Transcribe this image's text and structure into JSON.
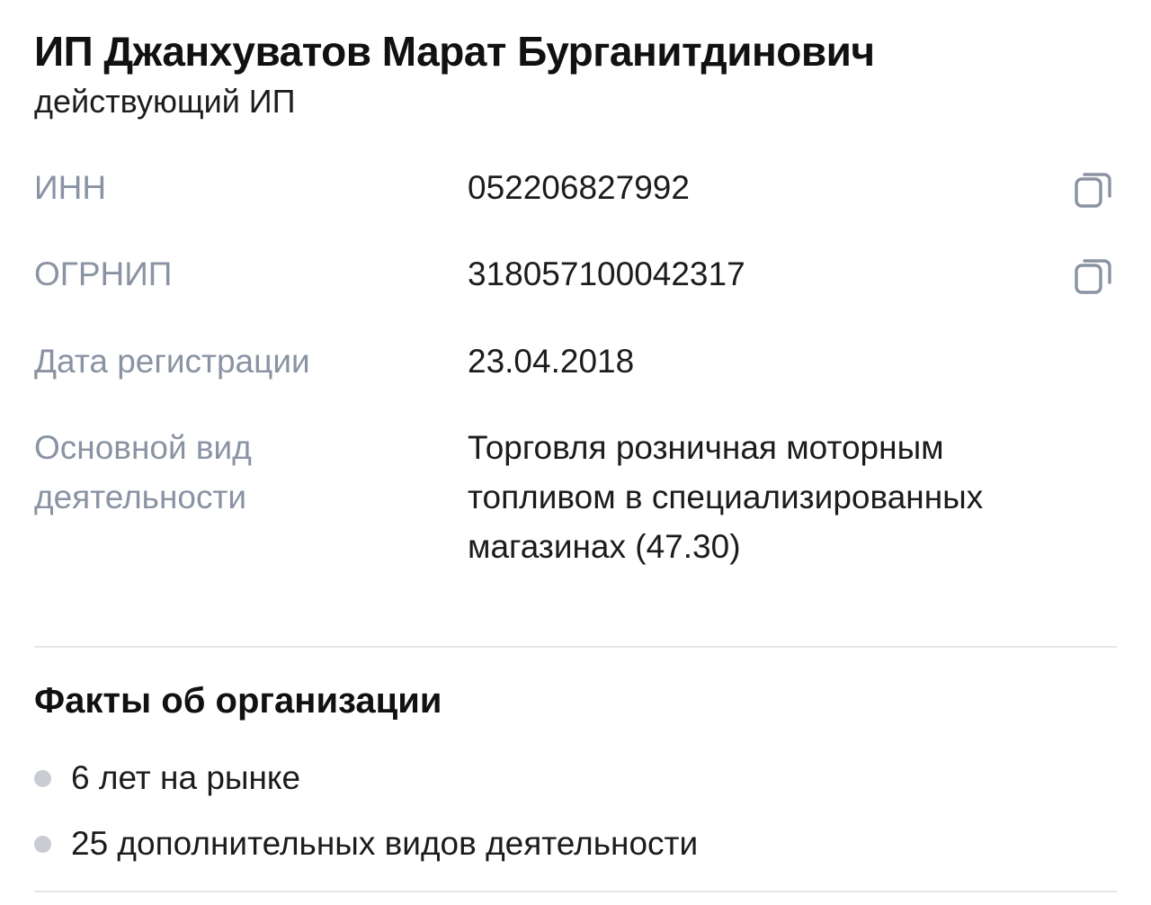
{
  "organization": {
    "name": "ИП Джанхуватов Марат Бурганитдинович",
    "status": "действующий ИП"
  },
  "details": [
    {
      "label": "ИНН",
      "value": "052206827992",
      "copy_icon": "copy-icon"
    },
    {
      "label": "ОГРНИП",
      "value": "318057100042317",
      "copy_icon": "copy-icon"
    },
    {
      "label": "Дата регистрации",
      "value": "23.04.2018"
    },
    {
      "label": "Основной вид деятельности",
      "value": "Торговля розничная моторным топливом в специализированных магазинах (47.30)"
    }
  ],
  "facts": {
    "title": "Факты об организации",
    "items": [
      "6 лет на рынке",
      "25 дополнительных видов деятельности"
    ]
  },
  "colors": {
    "label": "#8a93a3",
    "text": "#1c1c1e",
    "divider": "#e3e5e9",
    "bullet": "#c9ccd3"
  }
}
